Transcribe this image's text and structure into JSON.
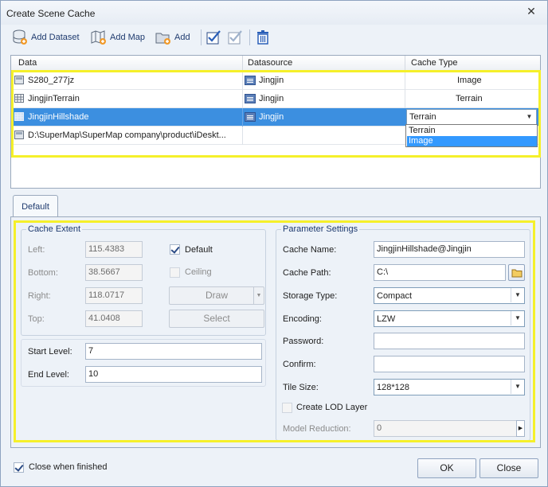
{
  "window": {
    "title": "Create Scene Cache"
  },
  "toolbar": {
    "add_dataset": "Add Dataset",
    "add_map": "Add Map",
    "add": "Add"
  },
  "grid": {
    "columns": [
      "Data",
      "Datasource",
      "Cache Type"
    ],
    "rows": [
      {
        "data": "S280_277jz",
        "datasource": "Jingjin",
        "cache_type": "Image"
      },
      {
        "data": "JingjinTerrain",
        "datasource": "Jingjin",
        "cache_type": "Terrain"
      },
      {
        "data": "JingjinHillshade",
        "datasource": "Jingjin",
        "cache_type": "Terrain"
      },
      {
        "data": "D:\\SuperMap\\SuperMap company\\product\\iDeskt...",
        "datasource": "",
        "cache_type": ""
      }
    ],
    "dropdown_options": [
      "Terrain",
      "Image"
    ]
  },
  "tabs": {
    "default": "Default"
  },
  "extent": {
    "title": "Cache Extent",
    "left_label": "Left:",
    "left_value": "115.4383",
    "bottom_label": "Bottom:",
    "bottom_value": "38.5667",
    "right_label": "Right:",
    "right_value": "118.0717",
    "top_label": "Top:",
    "top_value": "41.0408",
    "default_label": "Default",
    "ceiling_label": "Ceiling",
    "draw_label": "Draw",
    "select_label": "Select"
  },
  "levels": {
    "start_label": "Start Level:",
    "start_value": "7",
    "end_label": "End Level:",
    "end_value": "10"
  },
  "params": {
    "title": "Parameter Settings",
    "cache_name_label": "Cache Name:",
    "cache_name_value": "JingjinHillshade@Jingjin",
    "cache_path_label": "Cache Path:",
    "cache_path_value": "C:\\",
    "storage_type_label": "Storage Type:",
    "storage_type_value": "Compact",
    "encoding_label": "Encoding:",
    "encoding_value": "LZW",
    "password_label": "Password:",
    "confirm_label": "Confirm:",
    "tile_size_label": "Tile Size:",
    "tile_size_value": "128*128",
    "lod_label": "Create LOD Layer",
    "model_reduction_label": "Model Reduction:",
    "model_reduction_value": "0"
  },
  "footer": {
    "close_when_finished": "Close when finished",
    "ok": "OK",
    "close": "Close"
  }
}
